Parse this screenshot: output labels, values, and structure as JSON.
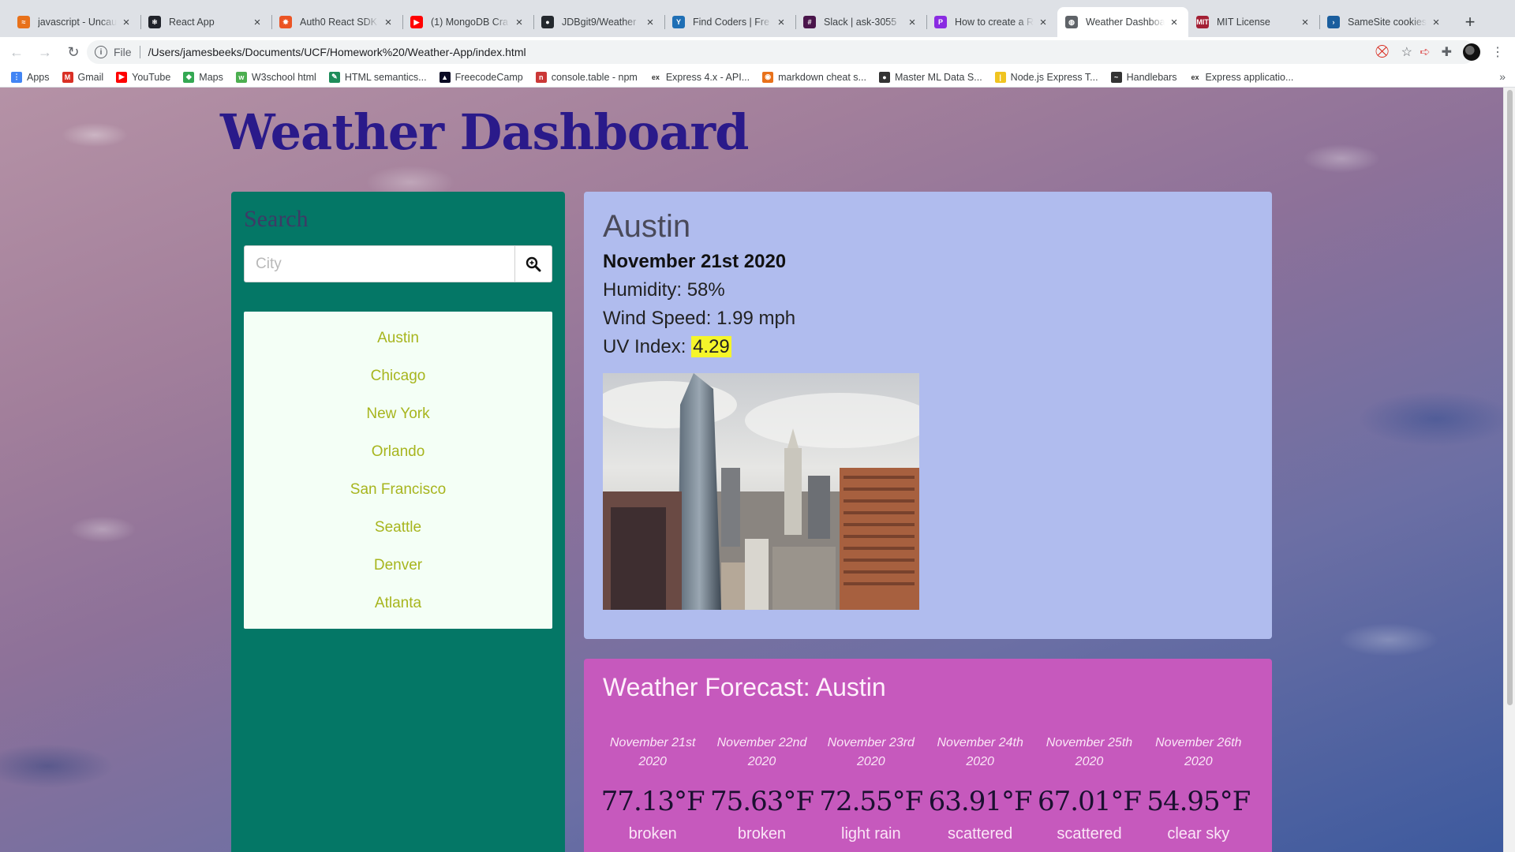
{
  "browser": {
    "tabs": [
      {
        "title": "javascript - Uncau",
        "color": "#e8711a",
        "glyph": "≈"
      },
      {
        "title": "React App",
        "color": "#20232a",
        "glyph": "⚛"
      },
      {
        "title": "Auth0 React SDK",
        "color": "#eb5424",
        "glyph": "✸"
      },
      {
        "title": "(1) MongoDB Cra",
        "color": "#ff0000",
        "glyph": "▶"
      },
      {
        "title": "JDBgit9/Weather",
        "color": "#24292e",
        "glyph": "●"
      },
      {
        "title": "Find Coders | Fre",
        "color": "#1f6fb5",
        "glyph": "Y"
      },
      {
        "title": "Slack | ask-3055",
        "color": "#4a154b",
        "glyph": "#"
      },
      {
        "title": "How to create a R",
        "color": "#8a2be2",
        "glyph": "P"
      },
      {
        "title": "Weather Dashboa",
        "color": "#5f6368",
        "glyph": "◍"
      },
      {
        "title": "MIT License",
        "color": "#a31f34",
        "glyph": "MIT"
      },
      {
        "title": "SameSite cookies",
        "color": "#1b5e9e",
        "glyph": "›"
      }
    ],
    "active_tab_index": 8,
    "address": {
      "scheme": "File",
      "url": "/Users/jamesbeeks/Documents/UCF/Homework%20/Weather-App/index.html"
    },
    "bookmarks": [
      {
        "label": "Apps",
        "color": "#4285f4",
        "glyph": "⋮"
      },
      {
        "label": "Gmail",
        "color": "#d93025",
        "glyph": "M"
      },
      {
        "label": "YouTube",
        "color": "#ff0000",
        "glyph": "▶"
      },
      {
        "label": "Maps",
        "color": "#34a853",
        "glyph": "◆"
      },
      {
        "label": "W3school html",
        "color": "#4caf50",
        "glyph": "w"
      },
      {
        "label": "HTML semantics...",
        "color": "#1e8c5a",
        "glyph": "✎"
      },
      {
        "label": "FreecodeCamp",
        "color": "#0a0a23",
        "glyph": "▲"
      },
      {
        "label": "console.table - npm",
        "color": "#cb3837",
        "glyph": "n"
      },
      {
        "label": "Express 4.x - API...",
        "color": "#ffffff",
        "glyph": "ex"
      },
      {
        "label": "markdown cheat s...",
        "color": "#e8711a",
        "glyph": "◉"
      },
      {
        "label": "Master ML Data S...",
        "color": "#333333",
        "glyph": "●"
      },
      {
        "label": "Node.js Express T...",
        "color": "#f0c420",
        "glyph": "|"
      },
      {
        "label": "Handlebars",
        "color": "#333333",
        "glyph": "~"
      },
      {
        "label": "Express applicatio...",
        "color": "#ffffff",
        "glyph": "ex"
      }
    ]
  },
  "page": {
    "title": "Weather Dashboard",
    "search": {
      "title": "Search",
      "placeholder": "City",
      "cities": [
        "Austin",
        "Chicago",
        "New York",
        "Orlando",
        "San Francisco",
        "Seattle",
        "Denver",
        "Atlanta"
      ]
    },
    "current": {
      "city": "Austin",
      "date": "November 21st 2020",
      "humidity": "Humidity: 58%",
      "wind": "Wind Speed: 1.99 mph",
      "uv_label": "UV Index: ",
      "uv_value": "4.29"
    },
    "forecast": {
      "title": "Weather Forecast: Austin",
      "days": [
        {
          "date": "November 21st 2020",
          "temp": "77.13°F",
          "desc": "broken"
        },
        {
          "date": "November 22nd 2020",
          "temp": "75.63°F",
          "desc": "broken"
        },
        {
          "date": "November 23rd 2020",
          "temp": "72.55°F",
          "desc": "light rain"
        },
        {
          "date": "November 24th 2020",
          "temp": "63.91°F",
          "desc": "scattered"
        },
        {
          "date": "November 25th 2020",
          "temp": "67.01°F",
          "desc": "scattered"
        },
        {
          "date": "November 26th 2020",
          "temp": "54.95°F",
          "desc": "clear sky"
        }
      ]
    }
  }
}
